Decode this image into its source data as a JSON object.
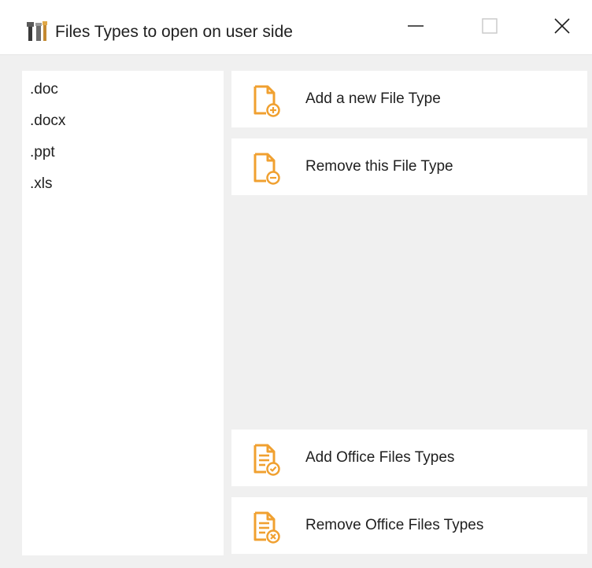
{
  "window": {
    "title": "Files Types to open on user side",
    "icon": "tools-app-icon"
  },
  "titlebar_controls": {
    "minimize": "minimize-icon",
    "maximize": "maximize-icon",
    "close": "close-icon"
  },
  "file_types": {
    "items": [
      ".doc",
      ".docx",
      ".ppt",
      ".xls"
    ],
    "selected": ".doc"
  },
  "actions": {
    "add_file_type": {
      "label": "Add a new File Type",
      "icon": "add-file-icon"
    },
    "remove_file_type": {
      "label": "Remove this File Type",
      "icon": "remove-file-icon"
    },
    "add_office_types": {
      "label": "Add Office Files Types",
      "icon": "document-check-icon"
    },
    "remove_office_types": {
      "label": "Remove Office Files Types",
      "icon": "document-remove-icon"
    }
  },
  "colors": {
    "accent": "#f0a030",
    "window_bg": "#f0f0f0",
    "panel_bg": "#ffffff"
  }
}
